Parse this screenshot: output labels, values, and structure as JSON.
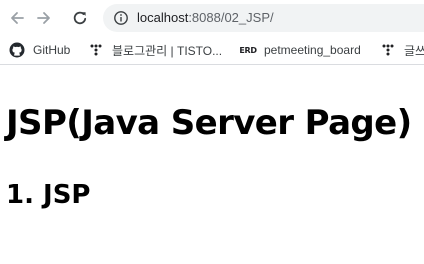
{
  "browser": {
    "url_host": "localhost",
    "url_rest": ":8088/02_JSP/",
    "icons": {
      "back": "arrow-left-icon",
      "forward": "arrow-right-icon",
      "reload": "reload-icon",
      "site_info": "info-icon"
    }
  },
  "bookmarks": [
    {
      "label": "GitHub",
      "icon": "github-icon"
    },
    {
      "label": "블로그관리 | TISTO...",
      "icon": "tistory-icon"
    },
    {
      "label": "petmeeting_board",
      "icon": "erd-icon",
      "icon_text": "ERD"
    },
    {
      "label": "글쓰",
      "icon": "tistory-icon"
    }
  ],
  "page": {
    "heading": "JSP(Java Server Page)",
    "subheading": "1. JSP"
  }
}
